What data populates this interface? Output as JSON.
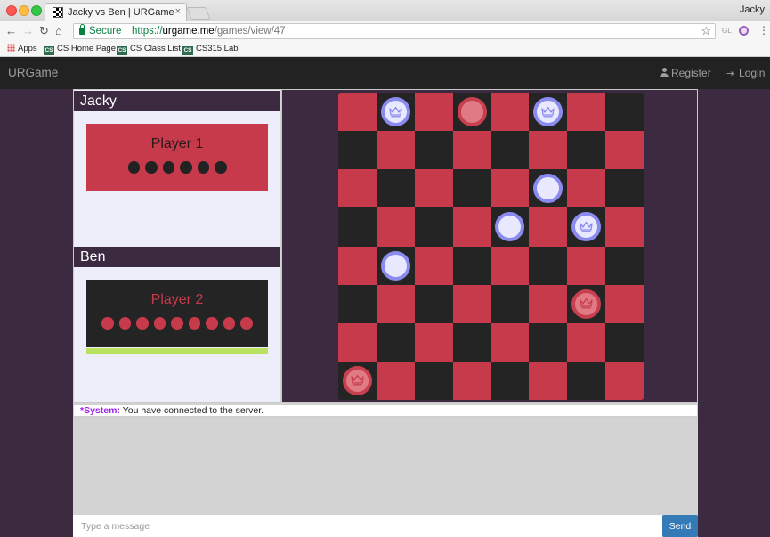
{
  "browser": {
    "tab_title": "Jacky vs Ben | URGame",
    "tab_close": "×",
    "profile_name": "Jacky",
    "secure_label": "Secure",
    "url_scheme": "https://",
    "url_host": "urgame.me",
    "url_path": "/games/view/47",
    "ext_label": "GL",
    "bookmarks": [
      {
        "label": "Apps",
        "icon": "apps-grid-icon"
      },
      {
        "label": "CS Home Page",
        "icon": "cs-icon"
      },
      {
        "label": "CS Class List",
        "icon": "cs-icon"
      },
      {
        "label": "CS315 Lab",
        "icon": "cs-icon"
      }
    ],
    "cs_badge": "CS"
  },
  "navbar": {
    "brand": "URGame",
    "register": "Register",
    "login": "Login"
  },
  "players": [
    {
      "name": "Jacky",
      "label": "Player 1",
      "pieces_remaining": 6,
      "color": "#222222",
      "card_color": "#c73a4c"
    },
    {
      "name": "Ben",
      "label": "Player 2",
      "pieces_remaining": 9,
      "color": "#c73a4c",
      "card_color": "#242424",
      "active_turn": true
    }
  ],
  "board": {
    "size": 8,
    "colors": {
      "light": "#c73a4c",
      "dark": "#242424",
      "blue_piece": "#8b8aee",
      "red_piece": "#c8404f"
    },
    "pieces": [
      {
        "row": 0,
        "col": 1,
        "color": "blue",
        "king": true
      },
      {
        "row": 0,
        "col": 3,
        "color": "red",
        "king": false
      },
      {
        "row": 0,
        "col": 5,
        "color": "blue",
        "king": true
      },
      {
        "row": 2,
        "col": 5,
        "color": "blue",
        "king": false
      },
      {
        "row": 3,
        "col": 4,
        "color": "blue",
        "king": false
      },
      {
        "row": 3,
        "col": 6,
        "color": "blue",
        "king": true
      },
      {
        "row": 4,
        "col": 1,
        "color": "blue",
        "king": false
      },
      {
        "row": 5,
        "col": 6,
        "color": "red",
        "king": true
      },
      {
        "row": 7,
        "col": 0,
        "color": "red",
        "king": true
      }
    ]
  },
  "chat": {
    "messages": [
      {
        "sender": "*System:",
        "text": "You have connected to the server."
      }
    ],
    "input_placeholder": "Type a message",
    "send_label": "Send"
  }
}
